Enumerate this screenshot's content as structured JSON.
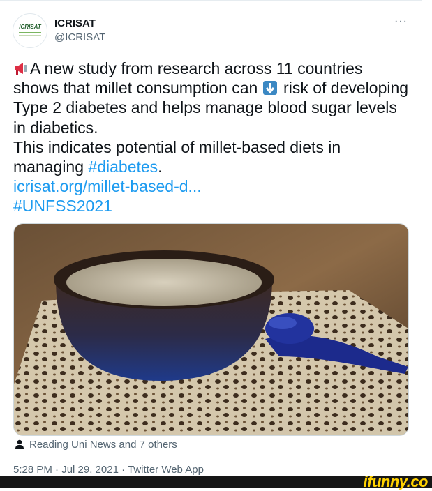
{
  "tweet": {
    "author_name": "ICRISAT",
    "author_handle": "@ICRISAT",
    "more_label": "···",
    "avatar_text": "ICRISAT",
    "line1_text": "A new study from research across 11 countries shows that millet consumption can ",
    "line1_after_emoji": " risk of developing Type 2 diabetes and helps manage blood sugar levels in diabetics.",
    "line2_text": "This indicates potential of millet-based diets in managing ",
    "hashtag_diabetes": "#diabetes",
    "line2_end": ".",
    "link_text": "icrisat.org/millet-based-d...",
    "hashtag_unfss": "#UNFSS2021",
    "social_context": "Reading Uni News and 7 others",
    "timestamp": "5:28 PM · Jul 29, 2021 · Twitter Web App"
  },
  "icons": {
    "megaphone": "megaphone-emoji",
    "down_arrow": "down-arrow-emoji",
    "person": "person-icon",
    "more": "more-icon"
  },
  "colors": {
    "link": "#1d9bf0",
    "text": "#0f1419",
    "secondary": "#536471",
    "watermark": "#ffd100"
  },
  "watermark": {
    "text": "ifunny.co"
  }
}
